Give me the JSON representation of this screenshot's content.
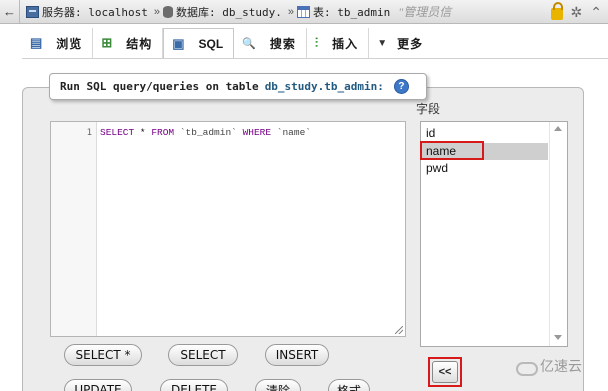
{
  "breadcrumb": {
    "back": "←",
    "server_label": "服务器: localhost",
    "db_label": "数据库: db_study.",
    "table_label": "表: tb_admin",
    "separator": "»",
    "tail": "\"管理员信"
  },
  "tabs": [
    {
      "label": "浏览",
      "icon": "browse-icon",
      "glyph": "▤"
    },
    {
      "label": "结构",
      "icon": "structure-icon",
      "glyph": "⊞"
    },
    {
      "label": "SQL",
      "icon": "sql-icon",
      "glyph": "▣"
    },
    {
      "label": "搜索",
      "icon": "search-icon",
      "glyph": "🔍"
    },
    {
      "label": "插入",
      "icon": "insert-icon",
      "glyph": "⫶"
    },
    {
      "label": "更多",
      "icon": "more-icon",
      "glyph": "▼"
    }
  ],
  "legend": {
    "text": "Run SQL query/queries on table",
    "table": "db_study.tb_admin:",
    "help": "?"
  },
  "editor": {
    "line_number": "1",
    "code_select": "SELECT",
    "code_star": " * ",
    "code_from": "FROM",
    "code_table": " `tb_admin` ",
    "code_where": "WHERE",
    "code_col": " `name`"
  },
  "columns": {
    "label": "字段",
    "options": [
      "id",
      "name",
      "pwd"
    ],
    "selected": "name",
    "insert_button": "<<"
  },
  "buttons": [
    "SELECT *",
    "SELECT",
    "INSERT",
    "UPDATE",
    "DELETE",
    "清除",
    "格式"
  ],
  "watermark": "亿速云",
  "colors": {
    "highlight_border": "#d61a1a",
    "table_name": "#235a81",
    "keyword": "#770088"
  }
}
